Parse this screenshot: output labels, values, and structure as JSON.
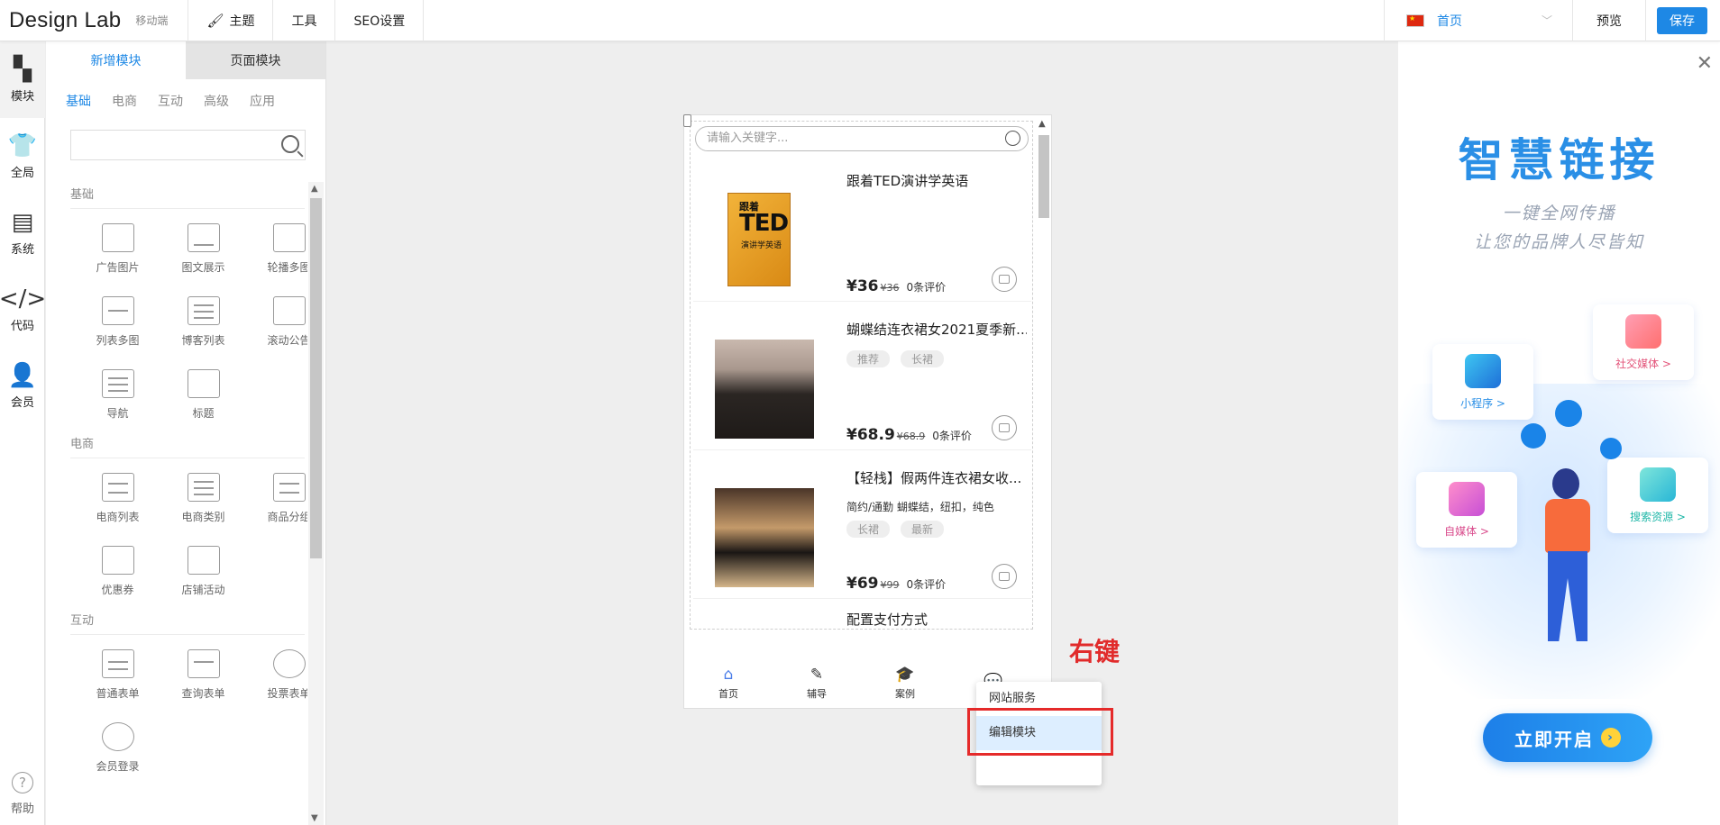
{
  "topbar": {
    "logo": "Design Lab",
    "device": "移动端",
    "nav": [
      {
        "label": "主题",
        "icon": "brush-icon"
      },
      {
        "label": "工具"
      },
      {
        "label": "SEO设置"
      }
    ],
    "page_select": "首页",
    "preview": "预览",
    "save": "保存"
  },
  "rail": {
    "items": [
      {
        "label": "模块",
        "icon": "modules-icon"
      },
      {
        "label": "全局",
        "icon": "shirt-icon"
      },
      {
        "label": "系统",
        "icon": "document-icon"
      },
      {
        "label": "代码",
        "icon": "code-icon"
      },
      {
        "label": "会员",
        "icon": "user-icon"
      }
    ],
    "help": "帮助"
  },
  "panel": {
    "tabs": [
      "新增模块",
      "页面模块"
    ],
    "categories": [
      "基础",
      "电商",
      "互动",
      "高级",
      "应用"
    ],
    "sections": [
      {
        "title": "基础",
        "items": [
          "广告图片",
          "图文展示",
          "轮播多图",
          "列表多图",
          "博客列表",
          "滚动公告",
          "导航",
          "标题"
        ]
      },
      {
        "title": "电商",
        "items": [
          "电商列表",
          "电商类别",
          "商品分组",
          "优惠券",
          "店铺活动"
        ]
      },
      {
        "title": "互动",
        "items": [
          "普通表单",
          "查询表单",
          "投票表单",
          "会员登录"
        ]
      }
    ]
  },
  "phone": {
    "search_placeholder": "请输入关键字...",
    "products": [
      {
        "name": "跟着TED演讲学英语",
        "price": "¥36",
        "old": "¥36",
        "reviews": "0条评价",
        "book_t1": "跟着",
        "book_t2": "TED",
        "book_t3": "演讲学英语"
      },
      {
        "name": "蝴蝶结连衣裙女2021夏季新...",
        "tags": [
          "推荐",
          "长裙"
        ],
        "price": "¥68.9",
        "old": "¥68.9",
        "reviews": "0条评价"
      },
      {
        "name": "【轻栈】假两件连衣裙女收...",
        "desc": "简约/通勤   蝴蝶结，纽扣，纯色",
        "tags": [
          "长裙",
          "最新"
        ],
        "price": "¥69",
        "old": "¥99",
        "reviews": "0条评价"
      },
      {
        "name": "配置支付方式"
      }
    ],
    "tabbar": [
      {
        "label": "首页",
        "icon": "home-icon"
      },
      {
        "label": "辅导",
        "icon": "pen-icon"
      },
      {
        "label": "案例",
        "icon": "graduation-icon"
      },
      {
        "label": "",
        "icon": "chat-icon"
      }
    ]
  },
  "context_menu": {
    "items": [
      "网站服务",
      "编辑模块"
    ],
    "annotation": "右键"
  },
  "promo": {
    "title": "智慧链接",
    "sub1": "一键全网传播",
    "sub2": "让您的品牌人尽皆知",
    "cards": [
      "小程序 >",
      "社交媒体 >",
      "自媒体 >",
      "搜索资源 >"
    ],
    "cta": "立即开启"
  },
  "colors": {
    "accent": "#1e88e5",
    "annotation_red": "#e52a2a"
  }
}
